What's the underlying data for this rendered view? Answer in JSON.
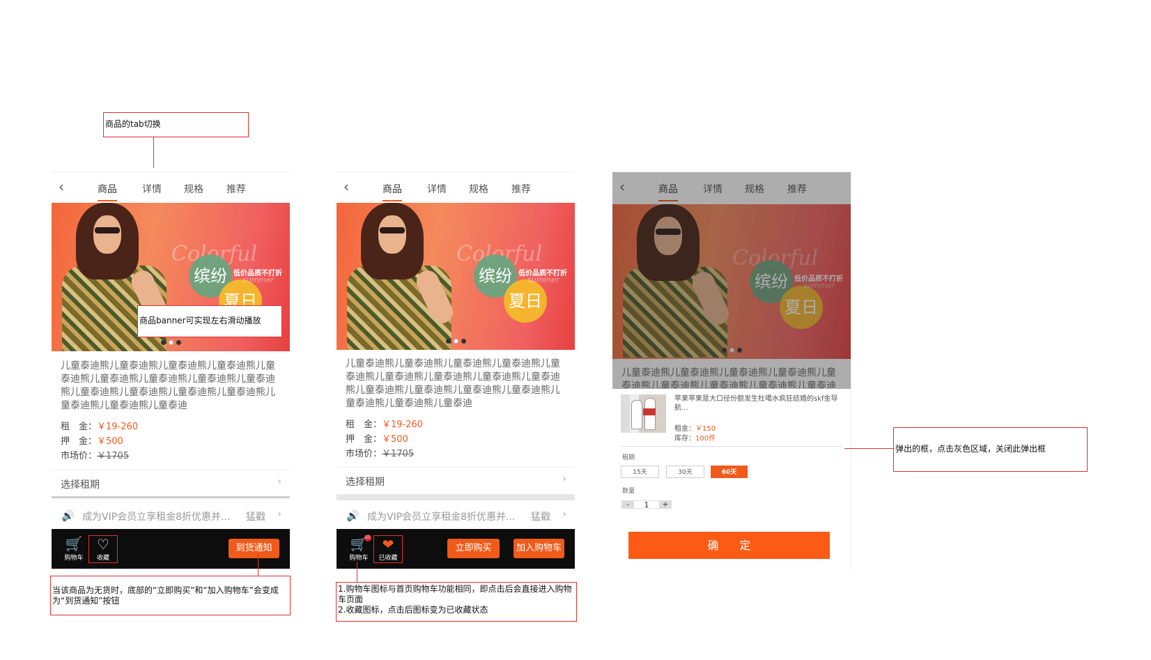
{
  "annotations": {
    "tab_switch": "商品的tab切换",
    "banner_slide": "商品banner可实现左右滑动播放",
    "out_of_stock": "当该商品为无货时，底部的“立即购买”和“加入购物车”会变成为“到货通知”按钮",
    "cart_fav_1": "1.购物车图标与首页购物车功能相同，即点击后会直接进入购物车页面",
    "cart_fav_2": "2.收藏图标，点击后图标变为已收藏状态",
    "popup": "弹出的框，点击灰色区域，关闭此弹出框"
  },
  "tabs": [
    "商品",
    "详情",
    "规格",
    "推荐"
  ],
  "back_icon": "back-arrow-icon",
  "banner": {
    "colorful": "Colorful",
    "summer": "summer",
    "word1": "缤纷",
    "word2": "夏日",
    "promo": "低价品质不打折"
  },
  "product": {
    "title": "儿童泰迪熊儿童泰迪熊儿童泰迪熊儿童泰迪熊儿童泰迪熊儿童泰迪熊儿童泰迪熊儿童泰迪熊儿童泰迪熊儿童泰迪熊儿童泰迪熊儿童泰迪熊儿童泰迪熊儿童泰迪熊儿童泰迪熊儿童泰迪",
    "rent_label": "租　金：",
    "rent_value": "￥19-260",
    "deposit_label": "押　金：",
    "deposit_value": "￥500",
    "market_label": "市场价：",
    "market_value": "￥1705",
    "choose_period": "选择租期"
  },
  "vip": {
    "text": "成为VIP会员立享租金8折优惠并...",
    "link": "猛戳"
  },
  "bottom": {
    "cart_label": "购物车",
    "fav_label": "收藏",
    "faved_label": "已收藏",
    "notify_button": "到货通知",
    "buy_now": "立即购买",
    "add_cart": "加入购物车",
    "cart_badge": "55"
  },
  "sheet": {
    "name": "苹果苹果是大口径份额发生杜噶水疯狂结婚的skf金导航...",
    "rent_label": "租金：",
    "rent_value": "￥150",
    "stock_label": "库存：",
    "stock_value": "100件",
    "period_label": "租期",
    "periods": [
      "15天",
      "30天",
      "60天"
    ],
    "selected_period": "60天",
    "qty_label": "数量",
    "qty_minus": "-",
    "qty_value": "1",
    "qty_plus": "+",
    "confirm": "确定"
  },
  "colors": {
    "accent": "#f05a1a",
    "annotation_border": "#e03030",
    "bottom_bar": "#0d0d0d"
  }
}
